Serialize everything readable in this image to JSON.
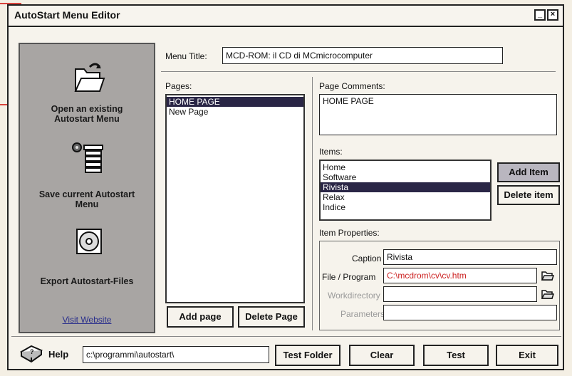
{
  "window": {
    "title": "AutoStart Menu Editor"
  },
  "left_panel": {
    "open_label": "Open an existing Autostart Menu",
    "save_label": "Save current Autostart Menu",
    "export_label": "Export Autostart-Files",
    "visit_link": "Visit Website"
  },
  "menu_title": {
    "label": "Menu Title:",
    "value": "MCD-ROM: il CD di MCmicrocomputer"
  },
  "pages": {
    "label": "Pages:",
    "items": [
      {
        "label": "HOME PAGE",
        "selected": true
      },
      {
        "label": "New Page",
        "selected": false
      }
    ],
    "add_button": "Add page",
    "delete_button": "Delete Page"
  },
  "page_comments": {
    "label": "Page Comments:",
    "value": "HOME PAGE"
  },
  "items": {
    "label": "Items:",
    "list": [
      {
        "label": "Home",
        "selected": false
      },
      {
        "label": "Software",
        "selected": false
      },
      {
        "label": "Rivista",
        "selected": true
      },
      {
        "label": "Relax",
        "selected": false
      },
      {
        "label": "Indice",
        "selected": false
      }
    ],
    "add_button": "Add Item",
    "delete_button": "Delete item"
  },
  "item_properties": {
    "label": "Item Properties:",
    "caption_label": "Caption",
    "caption_value": "Rivista",
    "file_label": "File / Program",
    "file_value": "C:\\mcdrom\\cv\\cv.htm",
    "workdir_label": "Workdirectory",
    "workdir_value": "",
    "params_label": "Parameters",
    "params_value": ""
  },
  "bottom": {
    "help_label": "Help",
    "path_value": "c:\\programmi\\autostart\\",
    "test_folder": "Test Folder",
    "clear": "Clear",
    "test": "Test",
    "exit": "Exit"
  },
  "colors": {
    "selection": "#2a2646",
    "left_panel": "#a8a5a3",
    "file_text": "#cc2222",
    "link": "#2a2f8c"
  }
}
